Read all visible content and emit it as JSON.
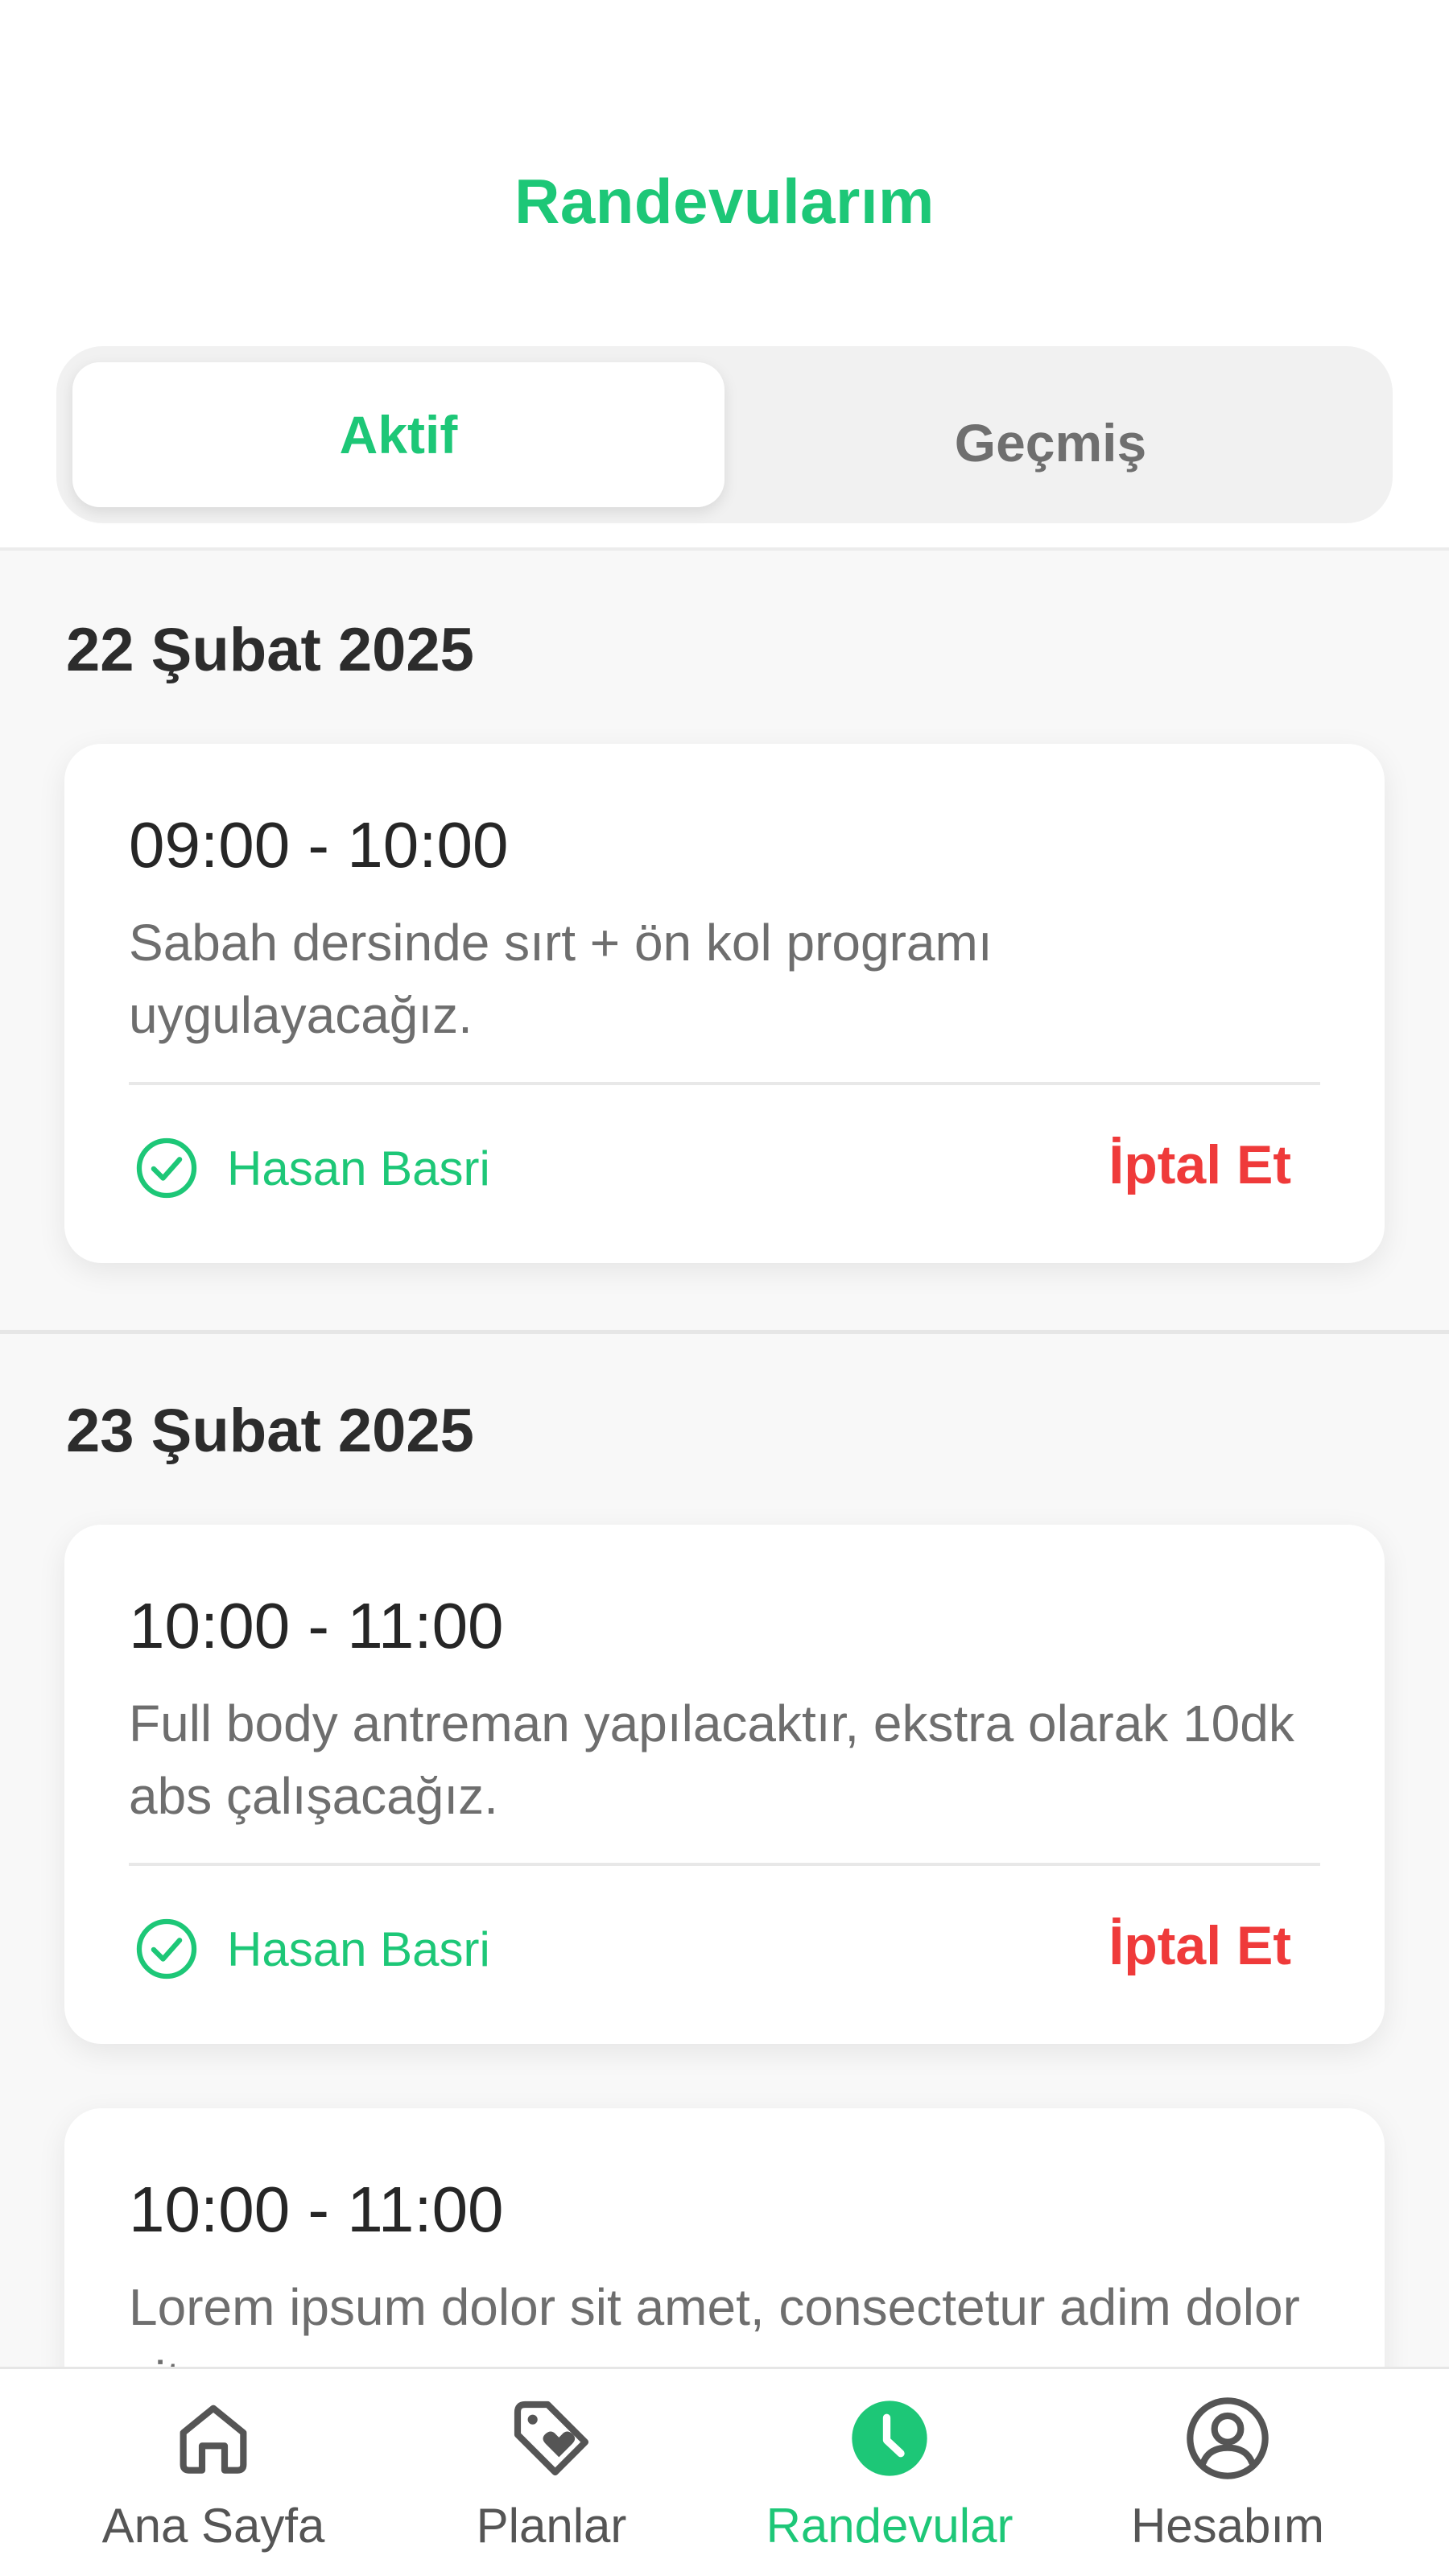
{
  "header": {
    "title": "Randevularım",
    "tabs": [
      {
        "label": "Aktif",
        "active": true
      },
      {
        "label": "Geçmiş",
        "active": false
      }
    ]
  },
  "sections": [
    {
      "date": "22 Şubat 2025",
      "appointments": [
        {
          "time": "09:00 - 10:00",
          "description": "Sabah dersinde sırt + ön kol programı uygulayacağız.",
          "trainer": "Hasan Basri",
          "cancel_label": "İptal Et"
        }
      ]
    },
    {
      "date": "23 Şubat 2025",
      "appointments": [
        {
          "time": "10:00 - 11:00",
          "description": "Full body antreman yapılacaktır, ekstra olarak 10dk abs çalışacağız.",
          "trainer": "Hasan Basri",
          "cancel_label": "İptal Et"
        },
        {
          "time": "10:00 - 11:00",
          "description": "Lorem ipsum dolor sit amet, consectetur adim dolor sit am"
        }
      ]
    }
  ],
  "bottom_nav": [
    {
      "label": "Ana Sayfa",
      "icon": "home-icon",
      "active": false
    },
    {
      "label": "Planlar",
      "icon": "tag-heart-icon",
      "active": false
    },
    {
      "label": "Randevular",
      "icon": "clock-icon",
      "active": true
    },
    {
      "label": "Hesabım",
      "icon": "user-circle-icon",
      "active": false
    }
  ],
  "colors": {
    "accent": "#1dc777",
    "danger": "#ef3a3a",
    "text_primary": "#262626",
    "text_secondary": "#6e6e6e",
    "background": "#f8f8f8"
  }
}
